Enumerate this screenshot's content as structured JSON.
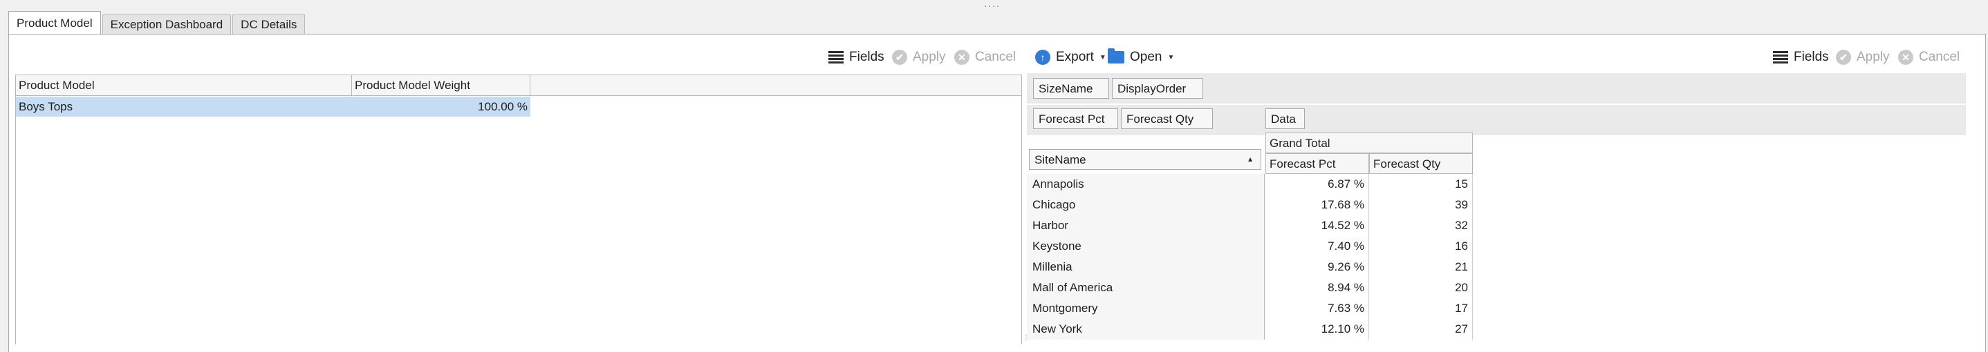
{
  "tabs": [
    "Product Model",
    "Exception Dashboard",
    "DC Details"
  ],
  "left_toolbar": {
    "fields": "Fields",
    "apply": "Apply",
    "cancel": "Cancel"
  },
  "left_grid": {
    "columns": [
      "Product Model",
      "Product Model Weight"
    ],
    "rows": [
      {
        "model": "Boys Tops",
        "weight": "100.00 %"
      }
    ]
  },
  "right_toolbar": {
    "export": "Export",
    "open": "Open",
    "fields": "Fields",
    "apply": "Apply",
    "cancel": "Cancel"
  },
  "pivot": {
    "filter_fields": [
      "SizeName",
      "DisplayOrder"
    ],
    "data_fields": [
      "Forecast Pct",
      "Forecast Qty"
    ],
    "column_area_label": "Data",
    "row_field": "SiteName",
    "grand_total": "Grand Total",
    "value_headers": [
      "Forecast Pct",
      "Forecast Qty"
    ],
    "rows": [
      {
        "site": "Annapolis",
        "pct": "6.87 %",
        "qty": "15"
      },
      {
        "site": "Chicago",
        "pct": "17.68 %",
        "qty": "39"
      },
      {
        "site": "Harbor",
        "pct": "14.52 %",
        "qty": "32"
      },
      {
        "site": "Keystone",
        "pct": "7.40 %",
        "qty": "16"
      },
      {
        "site": "Millenia",
        "pct": "9.26 %",
        "qty": "21"
      },
      {
        "site": "Mall of America",
        "pct": "8.94 %",
        "qty": "20"
      },
      {
        "site": "Montgomery",
        "pct": "7.63 %",
        "qty": "17"
      },
      {
        "site": "New York",
        "pct": "12.10 %",
        "qty": "27"
      }
    ]
  }
}
